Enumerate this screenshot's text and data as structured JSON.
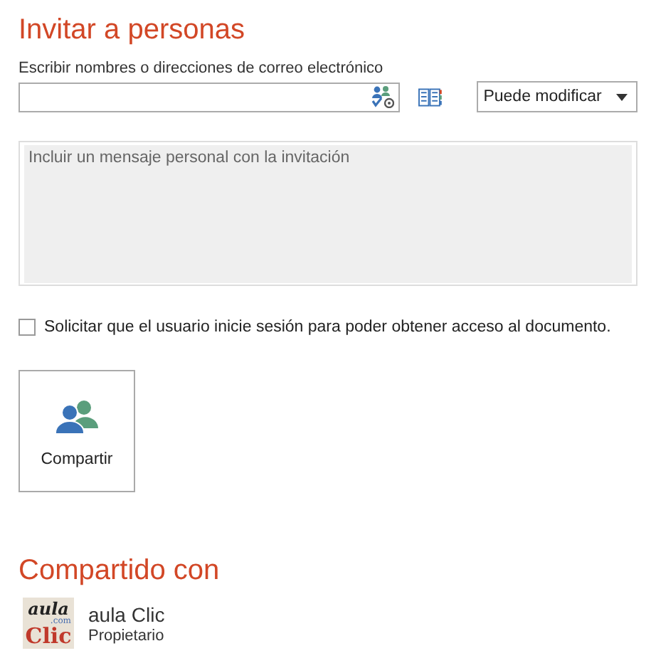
{
  "title": "Invitar a personas",
  "recipients": {
    "label": "Escribir nombres o direcciones de correo electrónico",
    "permission": "Puede modificar"
  },
  "message": {
    "placeholder": "Incluir un mensaje personal con la invitación"
  },
  "require_signin": {
    "label": "Solicitar que el usuario inicie sesión para poder obtener acceso al documento.",
    "checked": false
  },
  "share_button": "Compartir",
  "shared_with": {
    "title": "Compartido con",
    "people": [
      {
        "name": "aula Clic",
        "role": "Propietario",
        "logo": {
          "top": "aula",
          "small": ".com",
          "bottom": "Clic"
        }
      }
    ]
  }
}
